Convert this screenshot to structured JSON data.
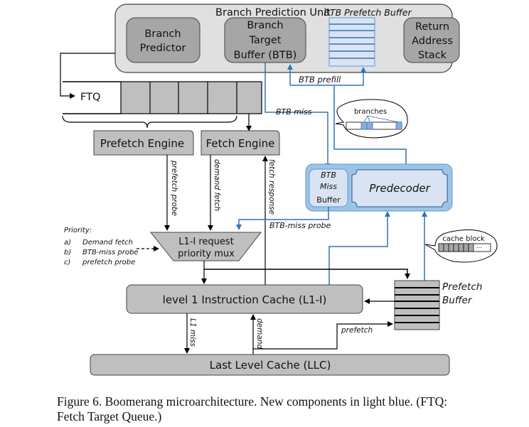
{
  "diagram": {
    "bpu": {
      "title": "Branch Prediction Unit",
      "prefetch_buffer_label": "BTB Prefetch Buffer",
      "branch_predictor": [
        "Branch",
        "Predictor"
      ],
      "btb": [
        "Branch",
        "Target",
        "Buffer (BTB)"
      ],
      "ras": [
        "Return",
        "Address",
        "Stack"
      ]
    },
    "ftq": {
      "label": "FTQ"
    },
    "prefetch_engine": "Prefetch Engine",
    "fetch_engine": "Fetch Engine",
    "arrows": {
      "btb_prefill": "BTB prefill",
      "btb_miss": "BTB miss",
      "prefetch_probe": "prefetch probe",
      "demand_fetch": "demand fetch",
      "fetch_response": "fetch response",
      "btb_miss_probe": "BTB-miss probe",
      "l1_miss": "L1 miss",
      "demand": "demand",
      "prefetch": "prefetch"
    },
    "bubble_branches": "branches",
    "bubble_cache_block": "cache block",
    "bubble_cache_block_ellipsis": "...",
    "btb_miss_buffer": [
      "BTB",
      "Miss",
      "Buffer"
    ],
    "predecoder": "Predecoder",
    "priority": {
      "title": "Priority:",
      "items": [
        {
          "key": "a)",
          "text": "Demand fetch"
        },
        {
          "key": "b)",
          "text": "BTB-miss probe"
        },
        {
          "key": "c)",
          "text": "prefetch probe"
        }
      ]
    },
    "mux": [
      "L1-I request",
      "priority  mux"
    ],
    "l1i": "level 1 Instruction Cache (L1-I)",
    "prefetch_buffer": [
      "Prefetch",
      "Buffer"
    ],
    "llc": "Last Level Cache (LLC)",
    "colors": {
      "component_gray": "#bfbfbf",
      "bpu_fill": "#e0e0e0",
      "new_component_blue": "#dae3f3",
      "new_outer_blue": "#9dc3e6",
      "blue_line": "#2e75b6"
    }
  },
  "caption": {
    "line1": "Figure 6.  Boomerang microarchitecture. New components in light blue. (FTQ:",
    "line2": "Fetch Target Queue.)"
  }
}
